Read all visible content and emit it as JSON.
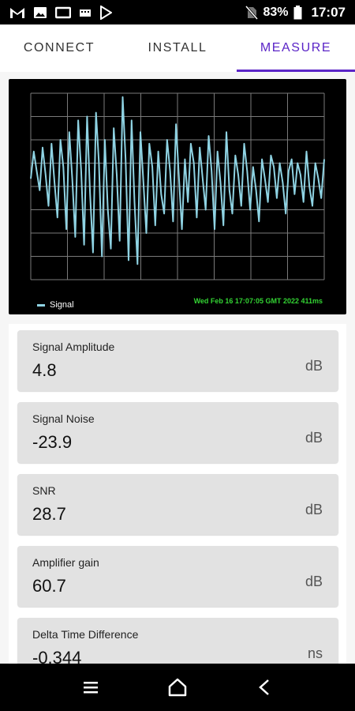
{
  "status_bar": {
    "battery": "83%",
    "time": "17:07",
    "icons": [
      "gmail-icon",
      "image-icon",
      "screen-icon",
      "sim-icon",
      "play-store-icon",
      "no-sim-icon",
      "battery-icon"
    ]
  },
  "tabs": [
    {
      "label": "CONNECT",
      "active": false
    },
    {
      "label": "INSTALL",
      "active": false
    },
    {
      "label": "MEASURE",
      "active": true
    }
  ],
  "chart_data": {
    "type": "line",
    "series": [
      {
        "name": "Signal",
        "color": "#8fd3e3",
        "values": [
          0.1,
          0.45,
          0.2,
          -0.05,
          0.5,
          0.15,
          -0.25,
          0.55,
          0.05,
          -0.4,
          0.6,
          0.25,
          -0.55,
          0.7,
          0.1,
          -0.65,
          0.85,
          0.2,
          -0.75,
          0.9,
          -0.1,
          -0.85,
          0.95,
          0.3,
          -0.9,
          0.6,
          -0.3,
          -0.8,
          0.75,
          0.15,
          -0.7,
          1.15,
          0.35,
          -0.95,
          0.85,
          -0.2,
          -1.0,
          0.7,
          0.05,
          -0.6,
          0.55,
          0.25,
          -0.5,
          0.45,
          -0.1,
          -0.35,
          0.6,
          0.2,
          -0.45,
          0.8,
          0.1,
          -0.55,
          0.35,
          -0.2,
          0.55,
          0.3,
          -0.4,
          0.5,
          0.1,
          -0.3,
          0.65,
          0.2,
          -0.55,
          0.45,
          0.05,
          -0.5,
          0.7,
          -0.05,
          -0.35,
          0.4,
          0.15,
          -0.25,
          0.55,
          0.2,
          -0.3,
          0.25,
          -0.05,
          -0.45,
          0.35,
          0.1,
          -0.2,
          0.4,
          0.25,
          -0.15,
          0.3,
          0.05,
          -0.35,
          0.2,
          0.35,
          -0.1,
          0.3,
          0.15,
          -0.2,
          0.45,
          0.0,
          -0.25,
          0.3,
          0.1,
          -0.15,
          0.35
        ]
      }
    ],
    "ylim": [
      -1.2,
      1.2
    ],
    "grid": true,
    "legend": "bottom-left",
    "timestamp": "Wed Feb 16 17:07:05 GMT 2022 411ms"
  },
  "measurements": [
    {
      "label": "Signal Amplitude",
      "value": "4.8",
      "unit": "dB"
    },
    {
      "label": "Signal Noise",
      "value": "-23.9",
      "unit": "dB"
    },
    {
      "label": "SNR",
      "value": "28.7",
      "unit": "dB"
    },
    {
      "label": "Amplifier gain",
      "value": "60.7",
      "unit": "dB"
    },
    {
      "label": "Delta Time Difference",
      "value": "-0.344",
      "unit": "ns"
    }
  ],
  "nav_bar": {
    "icons": [
      "menu-icon",
      "home-icon",
      "back-icon"
    ]
  }
}
